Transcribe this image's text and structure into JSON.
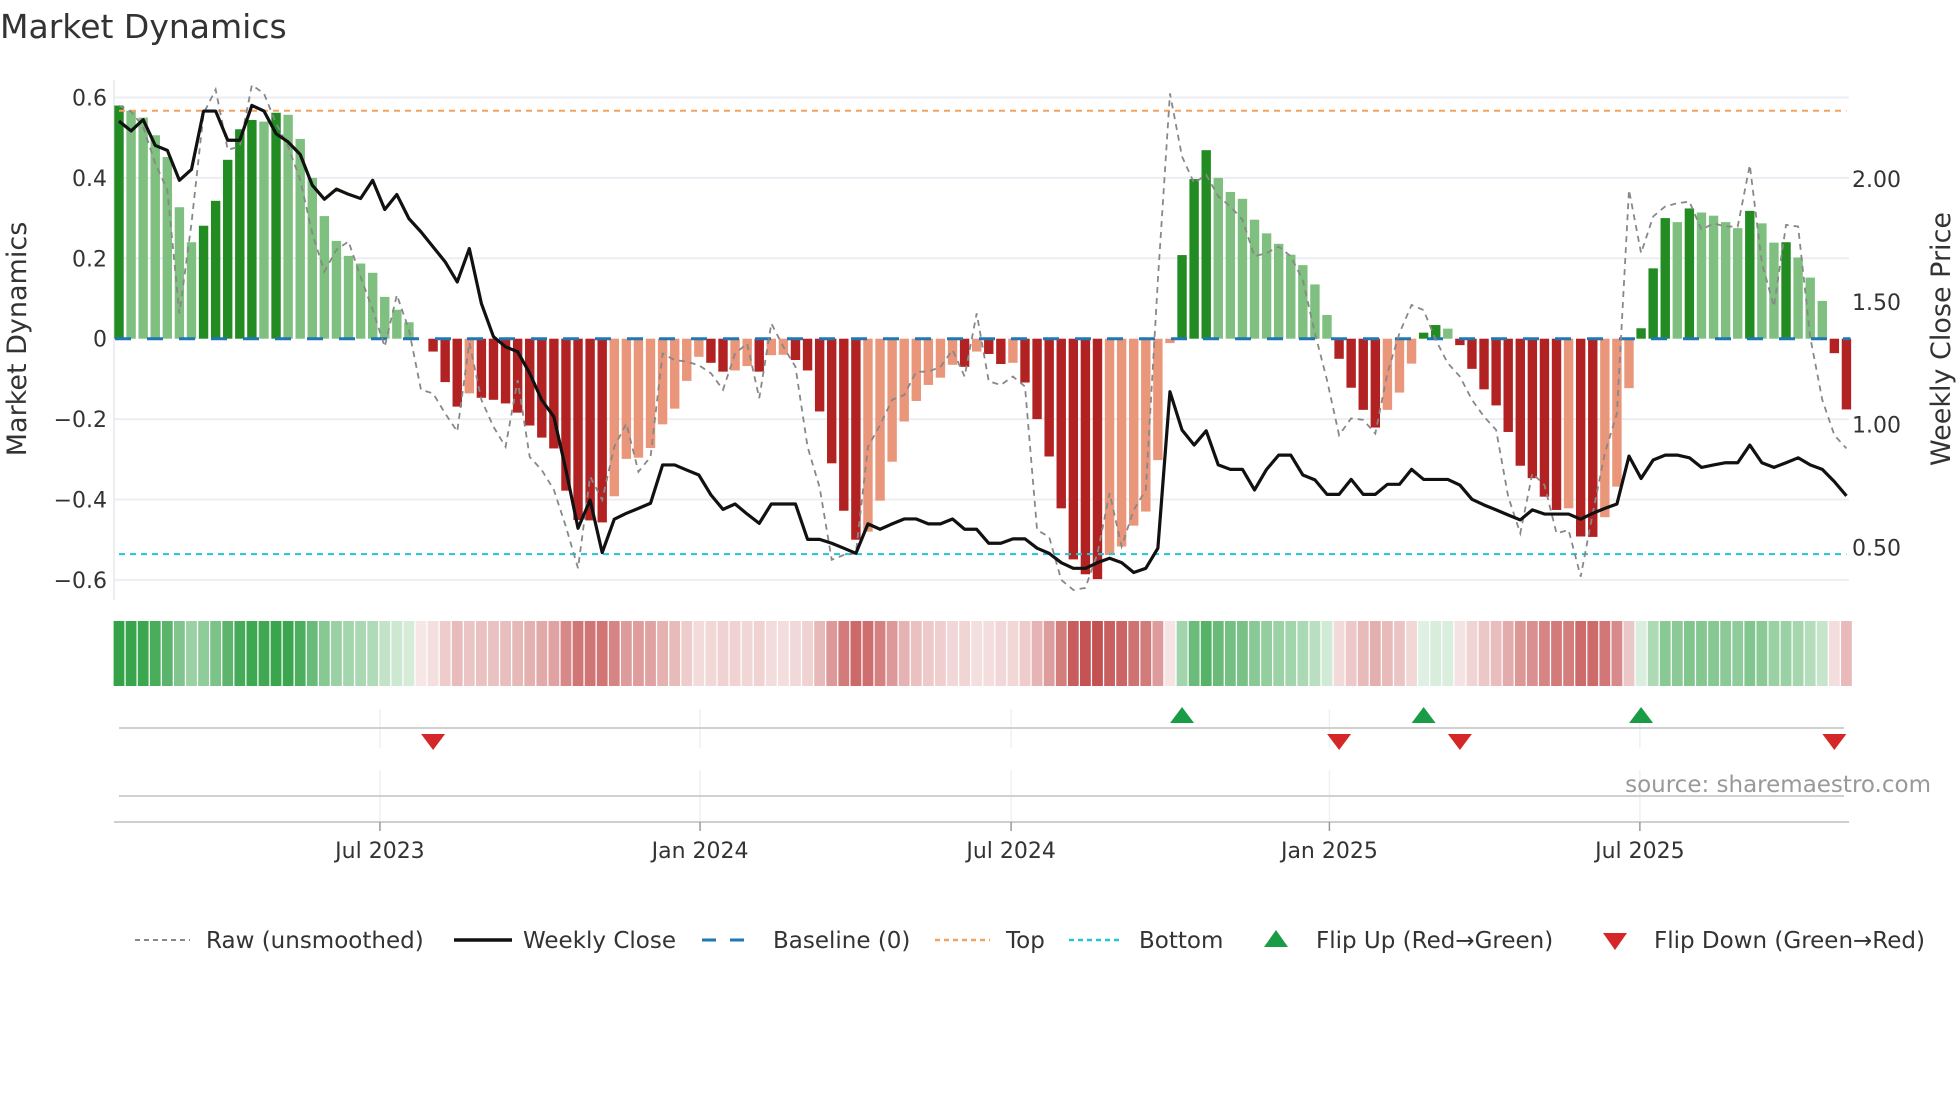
{
  "chart_data": {
    "type": "bar",
    "title": "Market Dynamics",
    "ylabel": "Market Dynamics",
    "y2label": "Weekly Close Price",
    "ylim": [
      -0.65,
      0.65
    ],
    "y2lim": [
      0.286,
      2.414
    ],
    "yticks": [
      {
        "v": 0.6,
        "label": "0.6"
      },
      {
        "v": 0.4,
        "label": "0.4"
      },
      {
        "v": 0.2,
        "label": "0.2"
      },
      {
        "v": 0,
        "label": "0"
      },
      {
        "v": -0.2,
        "label": "−0.2"
      },
      {
        "v": -0.4,
        "label": "−0.4"
      },
      {
        "v": -0.6,
        "label": "−0.6"
      }
    ],
    "y2ticks": [
      {
        "v": 2.0,
        "label": "2.00"
      },
      {
        "v": 1.5,
        "label": "1.50"
      },
      {
        "v": 1.0,
        "label": "1.00"
      },
      {
        "v": 0.5,
        "label": "0.50"
      }
    ],
    "xticks": [
      {
        "week": 21.6,
        "label": "Jul 2023"
      },
      {
        "week": 48.1,
        "label": "Jan 2024"
      },
      {
        "week": 73.85,
        "label": "Jul 2024"
      },
      {
        "week": 100.2,
        "label": "Jan 2025"
      },
      {
        "week": 125.9,
        "label": "Jul 2025"
      }
    ],
    "grid": true,
    "top_level": 0.567,
    "bottom_level": -0.536,
    "baseline": 0,
    "values": [
      0.58,
      0.567,
      0.55,
      0.506,
      0.452,
      0.327,
      0.24,
      0.281,
      0.343,
      0.445,
      0.521,
      0.544,
      0.54,
      0.562,
      0.557,
      0.497,
      0.4,
      0.305,
      0.243,
      0.206,
      0.187,
      0.164,
      0.104,
      0.072,
      0.041,
      0.0,
      -0.032,
      -0.108,
      -0.169,
      -0.136,
      -0.147,
      -0.152,
      -0.161,
      -0.184,
      -0.216,
      -0.246,
      -0.273,
      -0.378,
      -0.451,
      -0.452,
      -0.457,
      -0.392,
      -0.299,
      -0.296,
      -0.272,
      -0.213,
      -0.174,
      -0.105,
      -0.045,
      -0.06,
      -0.082,
      -0.079,
      -0.068,
      -0.082,
      -0.041,
      -0.04,
      -0.053,
      -0.079,
      -0.181,
      -0.31,
      -0.428,
      -0.5,
      -0.48,
      -0.403,
      -0.306,
      -0.206,
      -0.155,
      -0.115,
      -0.097,
      -0.065,
      -0.07,
      -0.032,
      -0.038,
      -0.063,
      -0.06,
      -0.109,
      -0.2,
      -0.293,
      -0.422,
      -0.549,
      -0.586,
      -0.598,
      -0.538,
      -0.517,
      -0.465,
      -0.43,
      -0.302,
      -0.011,
      0.208,
      0.397,
      0.469,
      0.4,
      0.365,
      0.348,
      0.296,
      0.262,
      0.236,
      0.209,
      0.183,
      0.135,
      0.059,
      -0.05,
      -0.122,
      -0.177,
      -0.221,
      -0.177,
      -0.134,
      -0.062,
      0.015,
      0.034,
      0.025,
      -0.016,
      -0.075,
      -0.126,
      -0.166,
      -0.232,
      -0.316,
      -0.347,
      -0.393,
      -0.426,
      -0.422,
      -0.492,
      -0.493,
      -0.444,
      -0.368,
      -0.123,
      0.026,
      0.175,
      0.3,
      0.29,
      0.324,
      0.314,
      0.306,
      0.29,
      0.275,
      0.318,
      0.287,
      0.239,
      0.24,
      0.202,
      0.152,
      0.094,
      -0.036,
      -0.176
    ],
    "raw": [
      0.58,
      0.565,
      0.527,
      0.436,
      0.37,
      0.063,
      0.287,
      0.56,
      0.62,
      0.47,
      0.478,
      0.631,
      0.61,
      0.536,
      0.478,
      0.395,
      0.262,
      0.167,
      0.221,
      0.242,
      0.154,
      0.072,
      -0.02,
      0.109,
      0.022,
      -0.127,
      -0.136,
      -0.186,
      -0.231,
      -0.01,
      -0.152,
      -0.219,
      -0.269,
      -0.103,
      -0.294,
      -0.327,
      -0.376,
      -0.468,
      -0.571,
      -0.343,
      -0.401,
      -0.269,
      -0.211,
      -0.331,
      -0.294,
      -0.037,
      -0.053,
      -0.057,
      -0.066,
      -0.086,
      -0.127,
      -0.037,
      -0.012,
      -0.148,
      0.038,
      -0.02,
      -0.07,
      -0.269,
      -0.37,
      -0.55,
      -0.538,
      -0.534,
      -0.269,
      -0.215,
      -0.152,
      -0.14,
      -0.082,
      -0.082,
      -0.07,
      -0.028,
      -0.094,
      0.063,
      -0.106,
      -0.115,
      -0.094,
      -0.119,
      -0.476,
      -0.493,
      -0.6,
      -0.625,
      -0.62,
      -0.534,
      -0.384,
      -0.517,
      -0.426,
      -0.376,
      0.146,
      0.61,
      0.453,
      0.387,
      0.408,
      0.354,
      0.329,
      0.296,
      0.205,
      0.213,
      0.229,
      0.205,
      0.146,
      0.014,
      -0.103,
      -0.24,
      -0.198,
      -0.202,
      -0.236,
      -0.086,
      0.014,
      0.084,
      0.071,
      -0.003,
      -0.061,
      -0.094,
      -0.152,
      -0.194,
      -0.227,
      -0.393,
      -0.484,
      -0.335,
      -0.364,
      -0.484,
      -0.476,
      -0.592,
      -0.434,
      -0.285,
      -0.186,
      0.37,
      0.213,
      0.304,
      0.329,
      0.337,
      0.341,
      0.271,
      0.287,
      0.279,
      0.279,
      0.432,
      0.188,
      0.08,
      0.283,
      0.279,
      0.004,
      -0.152,
      -0.24,
      -0.273
    ],
    "close": [
      2.236,
      2.196,
      2.242,
      2.137,
      2.117,
      1.995,
      2.039,
      2.277,
      2.277,
      2.158,
      2.158,
      2.3,
      2.277,
      2.185,
      2.151,
      2.1,
      1.975,
      1.918,
      1.959,
      1.938,
      1.921,
      1.995,
      1.876,
      1.937,
      1.839,
      1.785,
      1.724,
      1.663,
      1.581,
      1.717,
      1.493,
      1.358,
      1.317,
      1.297,
      1.209,
      1.1,
      1.032,
      0.815,
      0.578,
      0.693,
      0.479,
      0.615,
      0.639,
      0.659,
      0.68,
      0.836,
      0.836,
      0.815,
      0.795,
      0.714,
      0.655,
      0.677,
      0.636,
      0.598,
      0.677,
      0.677,
      0.677,
      0.533,
      0.533,
      0.517,
      0.497,
      0.476,
      0.596,
      0.574,
      0.596,
      0.616,
      0.616,
      0.596,
      0.596,
      0.616,
      0.574,
      0.574,
      0.517,
      0.517,
      0.535,
      0.535,
      0.497,
      0.476,
      0.438,
      0.415,
      0.415,
      0.438,
      0.456,
      0.438,
      0.398,
      0.415,
      0.497,
      1.134,
      0.978,
      0.917,
      0.975,
      0.836,
      0.818,
      0.818,
      0.734,
      0.818,
      0.876,
      0.876,
      0.795,
      0.775,
      0.716,
      0.716,
      0.777,
      0.716,
      0.716,
      0.757,
      0.757,
      0.818,
      0.777,
      0.777,
      0.777,
      0.754,
      0.696,
      0.673,
      0.653,
      0.632,
      0.612,
      0.653,
      0.636,
      0.636,
      0.636,
      0.615,
      0.639,
      0.659,
      0.677,
      0.872,
      0.781,
      0.856,
      0.876,
      0.876,
      0.865,
      0.826,
      0.836,
      0.845,
      0.845,
      0.917,
      0.845,
      0.826,
      0.845,
      0.865,
      0.836,
      0.818,
      0.768,
      0.71
    ],
    "flip_up_weeks": [
      88,
      108,
      126
    ],
    "flip_down_weeks": [
      26,
      101,
      111,
      142
    ],
    "colors": {
      "up_strong": "#228b22",
      "up_weak": "#7fbf7f",
      "down_strong": "#b22222",
      "down_weak": "#e9967a",
      "close": "#111111",
      "raw": "#888888",
      "baseline": "#1f77b4",
      "top": "#f4a261",
      "bottom": "#22c4d6",
      "flip_up": "#1a9c47",
      "flip_down": "#d62728",
      "strip_green": "46,160,67",
      "strip_red": "196,80,80"
    },
    "legend": [
      {
        "key": "raw",
        "label": "Raw (unsmoothed)"
      },
      {
        "key": "close",
        "label": "Weekly Close"
      },
      {
        "key": "baseline",
        "label": "Baseline (0)"
      },
      {
        "key": "top",
        "label": "Top"
      },
      {
        "key": "bottom",
        "label": "Bottom"
      },
      {
        "key": "flip_up",
        "label": "Flip Up (Red→Green)"
      },
      {
        "key": "flip_down",
        "label": "Flip Down (Green→Red)"
      }
    ],
    "legend_position": "bottom",
    "source": "source: sharemaestro.com"
  }
}
